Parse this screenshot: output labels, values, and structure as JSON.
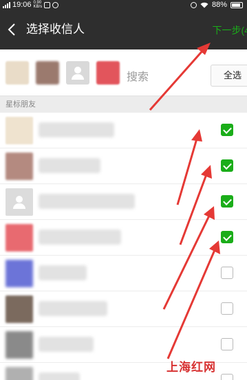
{
  "status_bar": {
    "time": "19:06",
    "net_speed_value": "0.90",
    "net_speed_unit": "KB/s",
    "battery": "88%"
  },
  "header": {
    "title": "选择收信人",
    "next_label": "下一步(4"
  },
  "search": {
    "placeholder": "搜索",
    "select_all_label": "全选"
  },
  "section": {
    "title": "星标朋友"
  },
  "contacts": [
    {
      "checked": true
    },
    {
      "checked": true
    },
    {
      "checked": true
    },
    {
      "checked": true
    },
    {
      "checked": false
    },
    {
      "checked": false
    },
    {
      "checked": false
    },
    {
      "checked": false
    }
  ],
  "colors": {
    "accent": "#1aad19",
    "title_bar": "#2e2e2e",
    "arrow": "#e53935"
  },
  "watermark": "上海红网"
}
